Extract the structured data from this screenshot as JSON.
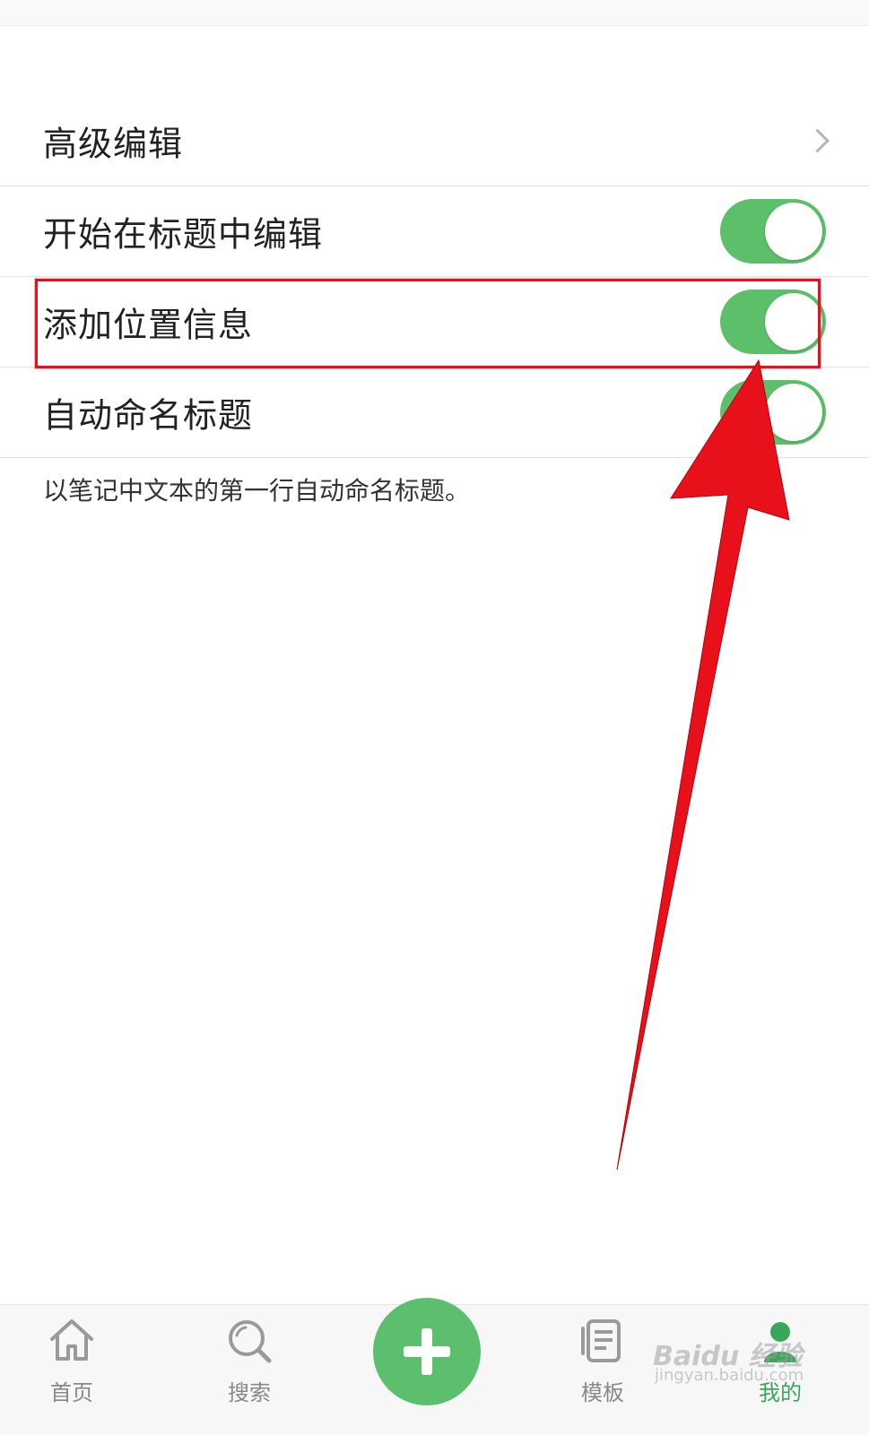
{
  "settings": {
    "items": [
      {
        "label": "高级编辑"
      },
      {
        "label": "开始在标题中编辑",
        "on": true
      },
      {
        "label": "添加位置信息",
        "on": true
      },
      {
        "label": "自动命名标题",
        "on": true
      }
    ],
    "note": "以笔记中文本的第一行自动命名标题。"
  },
  "tabbar": {
    "home": "首页",
    "search": "搜索",
    "templates": "模板",
    "mine": "我的"
  },
  "watermark": {
    "line1": "Baidu 经验",
    "line2": "jingyan.baidu.com"
  },
  "colors": {
    "accent": "#5cc06a",
    "annotation": "#e8111b"
  }
}
